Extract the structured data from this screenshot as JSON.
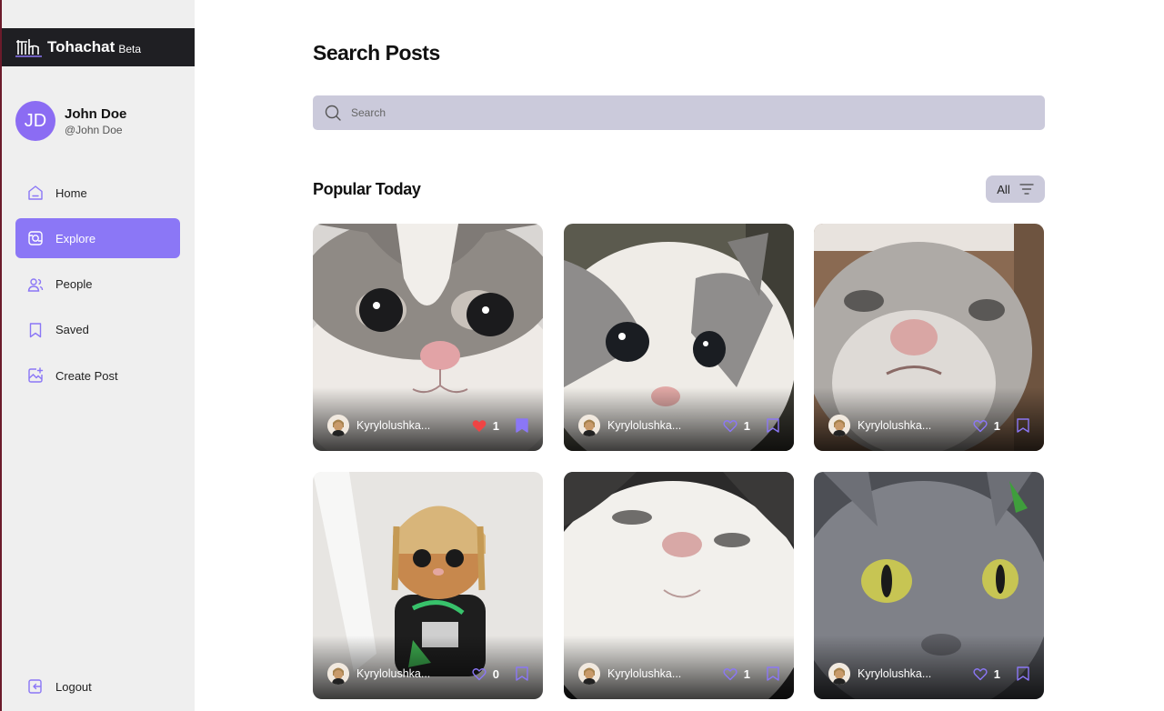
{
  "app": {
    "name": "Tohachat",
    "badge": "Beta"
  },
  "user": {
    "initials": "JD",
    "name": "John Doe",
    "handle": "@John Doe"
  },
  "nav": {
    "items": [
      {
        "label": "Home",
        "icon": "home-icon",
        "active": false
      },
      {
        "label": "Explore",
        "icon": "explore-icon",
        "active": true
      },
      {
        "label": "People",
        "icon": "people-icon",
        "active": false
      },
      {
        "label": "Saved",
        "icon": "bookmark-icon",
        "active": false
      },
      {
        "label": "Create Post",
        "icon": "create-post-icon",
        "active": false
      }
    ],
    "logout": "Logout"
  },
  "main": {
    "title": "Search Posts",
    "search": {
      "placeholder": "Search",
      "value": ""
    },
    "section_title": "Popular Today",
    "filter_label": "All"
  },
  "colors": {
    "accent": "#8b77f6",
    "liked": "#ef4444",
    "search_bg": "#cbcadb",
    "brand_bar": "#1f1f23"
  },
  "posts": [
    {
      "author": "Kyrylolushka...",
      "likes": "1",
      "liked": true,
      "saved": true,
      "image": "grey-white kitten close-up"
    },
    {
      "author": "Kyrylolushka...",
      "likes": "1",
      "liked": false,
      "saved": false,
      "image": "white and grey kitten"
    },
    {
      "author": "Kyrylolushka...",
      "likes": "1",
      "liked": false,
      "saved": false,
      "image": "grey kitten pressed to glass"
    },
    {
      "author": "Kyrylolushka...",
      "likes": "0",
      "liked": false,
      "saved": false,
      "image": "kitten wearing hat and t-shirt"
    },
    {
      "author": "Kyrylolushka...",
      "likes": "1",
      "liked": false,
      "saved": false,
      "image": "white cat looking up"
    },
    {
      "author": "Kyrylolushka...",
      "likes": "1",
      "liked": false,
      "saved": false,
      "image": "grey cat with yellow eyes"
    }
  ]
}
